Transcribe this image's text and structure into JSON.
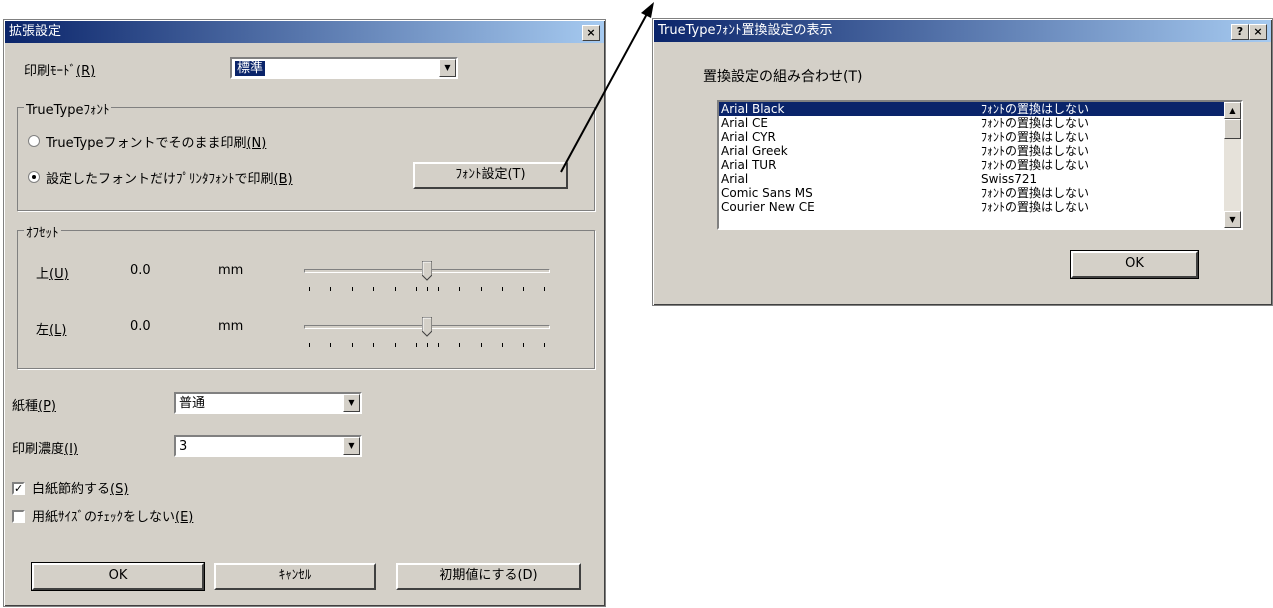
{
  "dialog1": {
    "title": "拡張設定",
    "close_label": "×",
    "print_mode": {
      "label": "印刷ﾓｰﾄﾞ",
      "accel": "(R)",
      "value": "標準"
    },
    "truetype_group": {
      "legend": "TrueTypeﾌｫﾝﾄ",
      "radio1": {
        "label": "TrueTypeフォントでそのまま印刷",
        "accel": "(N)",
        "selected": false
      },
      "radio2": {
        "label": "設定したフォントだけﾌﾟﾘﾝﾀﾌｫﾝﾄで印刷",
        "accel": "(B)",
        "selected": true
      },
      "font_button": "ﾌｫﾝﾄ設定(T)"
    },
    "offset_group": {
      "legend": "ｵﾌｾｯﾄ",
      "top": {
        "label": "上",
        "accel": "(U)",
        "value": "0.0",
        "unit": "mm",
        "slider_fraction": 0.5
      },
      "left": {
        "label": "左",
        "accel": "(L)",
        "value": "0.0",
        "unit": "mm",
        "slider_fraction": 0.5
      }
    },
    "paper_type": {
      "label": "紙種",
      "accel": "(P)",
      "value": "普通"
    },
    "density": {
      "label": "印刷濃度",
      "accel": "(I)",
      "value": "3"
    },
    "check_blank": {
      "label": "白紙節約する",
      "accel": "(S)",
      "checked": true
    },
    "check_size": {
      "label": "用紙ｻｲｽﾞのﾁｪｯｸをしない",
      "accel": "(E)",
      "checked": false
    },
    "buttons": {
      "ok": "OK",
      "cancel": "ｷｬﾝｾﾙ",
      "defaults": "初期値にする(D)"
    }
  },
  "dialog2": {
    "title": "TrueTypeﾌｫﾝﾄ置換設定の表示",
    "help_label": "?",
    "close_label": "×",
    "list_label": "置換設定の組み合わせ(T)",
    "rows": [
      {
        "font": "Arial Black",
        "sub": "ﾌｫﾝﾄの置換はしない",
        "selected": true
      },
      {
        "font": "Arial CE",
        "sub": "ﾌｫﾝﾄの置換はしない",
        "selected": false
      },
      {
        "font": "Arial CYR",
        "sub": "ﾌｫﾝﾄの置換はしない",
        "selected": false
      },
      {
        "font": "Arial Greek",
        "sub": "ﾌｫﾝﾄの置換はしない",
        "selected": false
      },
      {
        "font": "Arial TUR",
        "sub": "ﾌｫﾝﾄの置換はしない",
        "selected": false
      },
      {
        "font": "Arial",
        "sub": "Swiss721",
        "selected": false
      },
      {
        "font": "Comic Sans MS",
        "sub": "ﾌｫﾝﾄの置換はしない",
        "selected": false
      },
      {
        "font": "Courier New CE",
        "sub": "ﾌｫﾝﾄの置換はしない",
        "selected": false
      }
    ],
    "ok": "OK"
  }
}
